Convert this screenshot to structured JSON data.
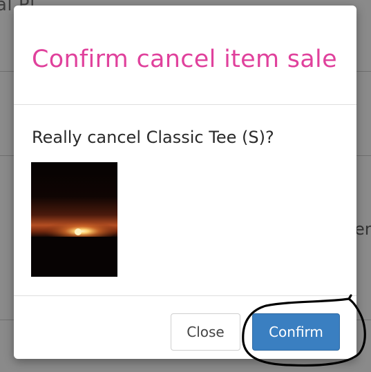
{
  "background": {
    "header_fragment": "al    Pl",
    "side_fragment": "en"
  },
  "modal": {
    "title": "Confirm cancel item sale",
    "message": "Really cancel Classic Tee (S)?",
    "image": {
      "icon": "sunset-photo"
    },
    "buttons": {
      "close_label": "Close",
      "confirm_label": "Confirm"
    }
  },
  "colors": {
    "title": "#e0419c",
    "confirm_button": "#3a7fc1",
    "annotation_stroke": "#000000"
  }
}
